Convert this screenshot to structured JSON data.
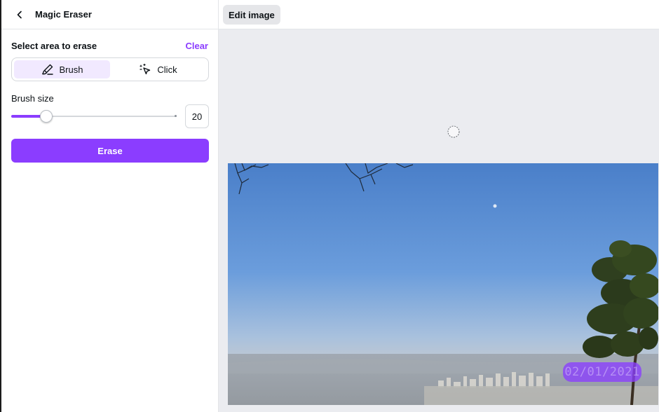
{
  "panel": {
    "title": "Magic Eraser",
    "section_label": "Select area to erase",
    "clear_label": "Clear",
    "modes": [
      {
        "label": "Brush",
        "icon": "brush-icon",
        "active": true
      },
      {
        "label": "Click",
        "icon": "magic-click-icon",
        "active": false
      }
    ],
    "brush_size_label": "Brush size",
    "brush_size_value": "20",
    "brush_size_fraction": 0.21,
    "erase_label": "Erase"
  },
  "canvas": {
    "edit_image_label": "Edit image",
    "date_stamp": "02/01/2021"
  },
  "colors": {
    "accent": "#8b3dff",
    "accent_light": "#f1e9ff",
    "canvas_bg": "#ebecf0"
  }
}
